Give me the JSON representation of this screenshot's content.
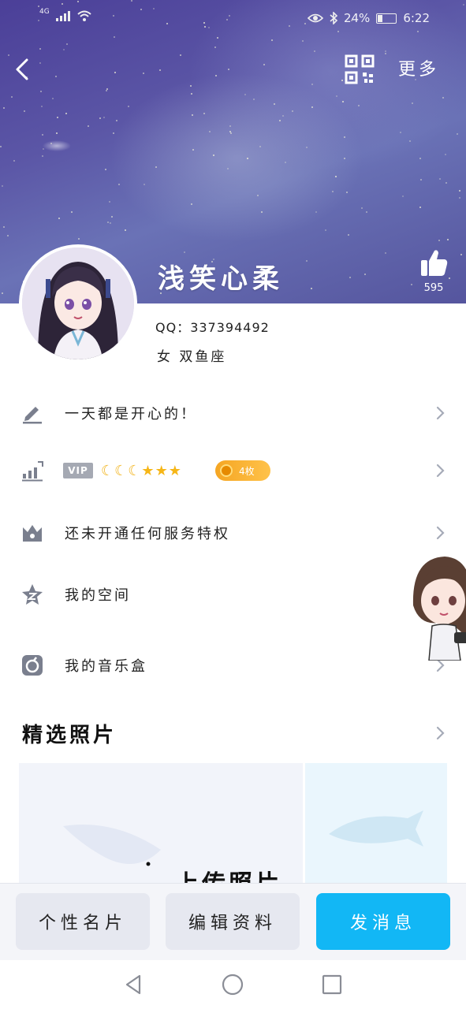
{
  "status_bar": {
    "network": "4G",
    "battery": "24%",
    "time": "6:22"
  },
  "nav": {
    "more_label": "更多"
  },
  "profile": {
    "nickname": "浅笑心柔",
    "likes": "595",
    "qq_line": "QQ：337394492",
    "gender_line": "女 双鱼座"
  },
  "rows": {
    "signature": "一天都是开心的！",
    "vip_tag": "VIP",
    "vip_coins": "4枚",
    "privilege": "还未开通任何服务特权",
    "space": "我的空间",
    "music": "我的音乐盒"
  },
  "photos": {
    "title": "精选照片",
    "upload_text": "上传照片"
  },
  "actions": {
    "card": "个性名片",
    "edit": "编辑资料",
    "message": "发消息"
  },
  "colors": {
    "accent": "#12b7f5",
    "coin": "#f5a623",
    "banner": "#5b56a6"
  }
}
